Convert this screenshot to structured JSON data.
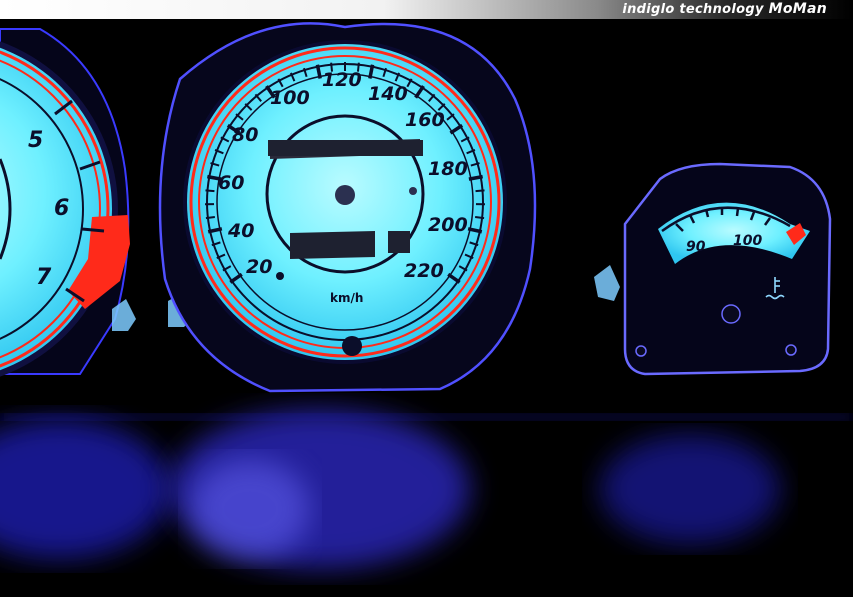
{
  "banner": {
    "prefix": "indiglo technology ",
    "brand": "MoMan"
  },
  "tachometer": {
    "labels": [
      "5",
      "6",
      "7"
    ]
  },
  "speedometer": {
    "labels": [
      "20",
      "40",
      "60",
      "80",
      "100",
      "120",
      "140",
      "160",
      "180",
      "200",
      "220"
    ],
    "unit": "km/h"
  },
  "temperature_gauge": {
    "labels": [
      "90",
      "100"
    ],
    "icon": "coolant-temperature-icon"
  },
  "colors": {
    "glow": "#5fe8ff",
    "redline": "#ff2a1a",
    "ambient": "#1a2cff",
    "dark": "#0b0e2a"
  }
}
